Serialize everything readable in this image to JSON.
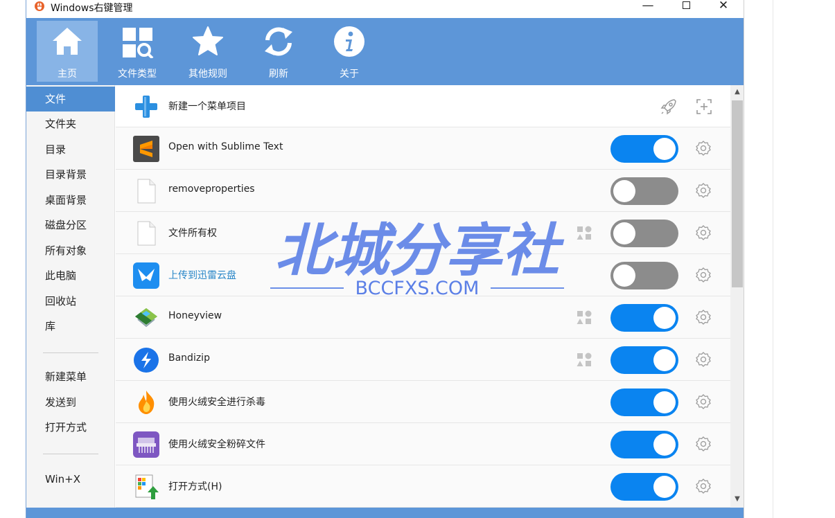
{
  "window": {
    "title": "Windows右键管理",
    "minimize": "—",
    "close": "✕"
  },
  "toolbar": {
    "items": [
      {
        "label": "主页",
        "icon": "home-icon"
      },
      {
        "label": "文件类型",
        "icon": "file-type-search-icon"
      },
      {
        "label": "其他规则",
        "icon": "star-icon"
      },
      {
        "label": "刷新",
        "icon": "refresh-icon"
      },
      {
        "label": "关于",
        "icon": "info-icon"
      }
    ]
  },
  "sidebar": {
    "items": [
      "文件",
      "文件夹",
      "目录",
      "目录背景",
      "桌面背景",
      "磁盘分区",
      "所有对象",
      "此电脑",
      "回收站",
      "库"
    ],
    "extra": [
      "新建菜单",
      "发送到",
      "打开方式"
    ],
    "last": "Win+X",
    "active": "文件"
  },
  "list": {
    "new_item_label": "新建一个菜单项目",
    "rows": [
      {
        "label": "Open with Sublime Text",
        "icon": "sublime-text-icon",
        "enabled": true,
        "shapes": false,
        "link": false
      },
      {
        "label": "removeproperties",
        "icon": "blank-file-icon",
        "enabled": false,
        "shapes": false,
        "link": false
      },
      {
        "label": "文件所有权",
        "icon": "blank-file-icon",
        "enabled": false,
        "shapes": true,
        "link": false
      },
      {
        "label": "上传到迅雷云盘",
        "icon": "xunlei-bird-icon",
        "enabled": false,
        "shapes": false,
        "link": true
      },
      {
        "label": "Honeyview",
        "icon": "honeyview-icon",
        "enabled": true,
        "shapes": true,
        "link": false
      },
      {
        "label": "Bandizip",
        "icon": "bandizip-icon",
        "enabled": true,
        "shapes": true,
        "link": false
      },
      {
        "label": "使用火绒安全进行杀毒",
        "icon": "huorong-flame-icon",
        "enabled": true,
        "shapes": false,
        "link": false
      },
      {
        "label": "使用火绒安全粉碎文件",
        "icon": "shredder-icon",
        "enabled": true,
        "shapes": false,
        "link": false
      },
      {
        "label": "打开方式(H)",
        "icon": "open-with-icon",
        "enabled": true,
        "shapes": false,
        "link": false
      }
    ]
  },
  "statusbar": {
    "text": ""
  },
  "watermark": {
    "title": "北城分享社",
    "subtitle": "BCCFXS.COM"
  },
  "colors": {
    "toolbar": "#5d96d8",
    "toolbar_active": "#88b4e6",
    "sidebar_active": "#4f8ed3",
    "toggle_on": "#0a84f0",
    "toggle_off": "#8c8c8c",
    "watermark": "#5b7fe6"
  }
}
